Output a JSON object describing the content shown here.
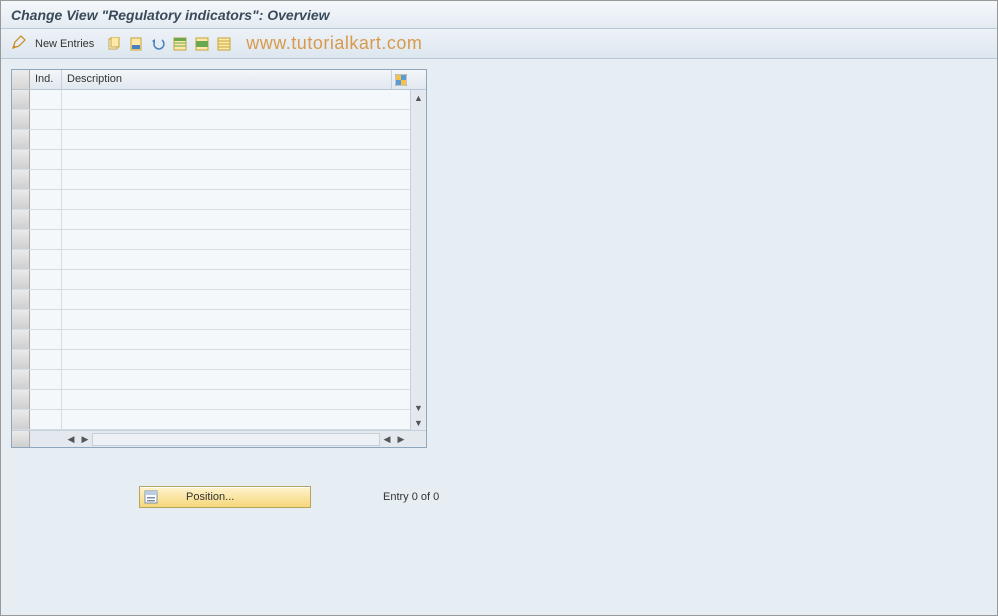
{
  "header": {
    "title": "Change View \"Regulatory indicators\": Overview"
  },
  "toolbar": {
    "new_entries_label": "New Entries",
    "watermark": "www.tutorialkart.com",
    "icons": {
      "pencil": "pencil-icon",
      "copy": "copy-icon",
      "delete": "delete-icon",
      "undo": "undo-icon",
      "select_all": "select-all-icon",
      "select_block": "select-block-icon",
      "deselect": "deselect-icon"
    }
  },
  "table": {
    "columns": {
      "ind": "Ind.",
      "description": "Description"
    },
    "row_count": 17,
    "config_icon": "table-settings-icon"
  },
  "footer": {
    "position_label": "Position...",
    "entry_text": "Entry 0 of 0"
  }
}
